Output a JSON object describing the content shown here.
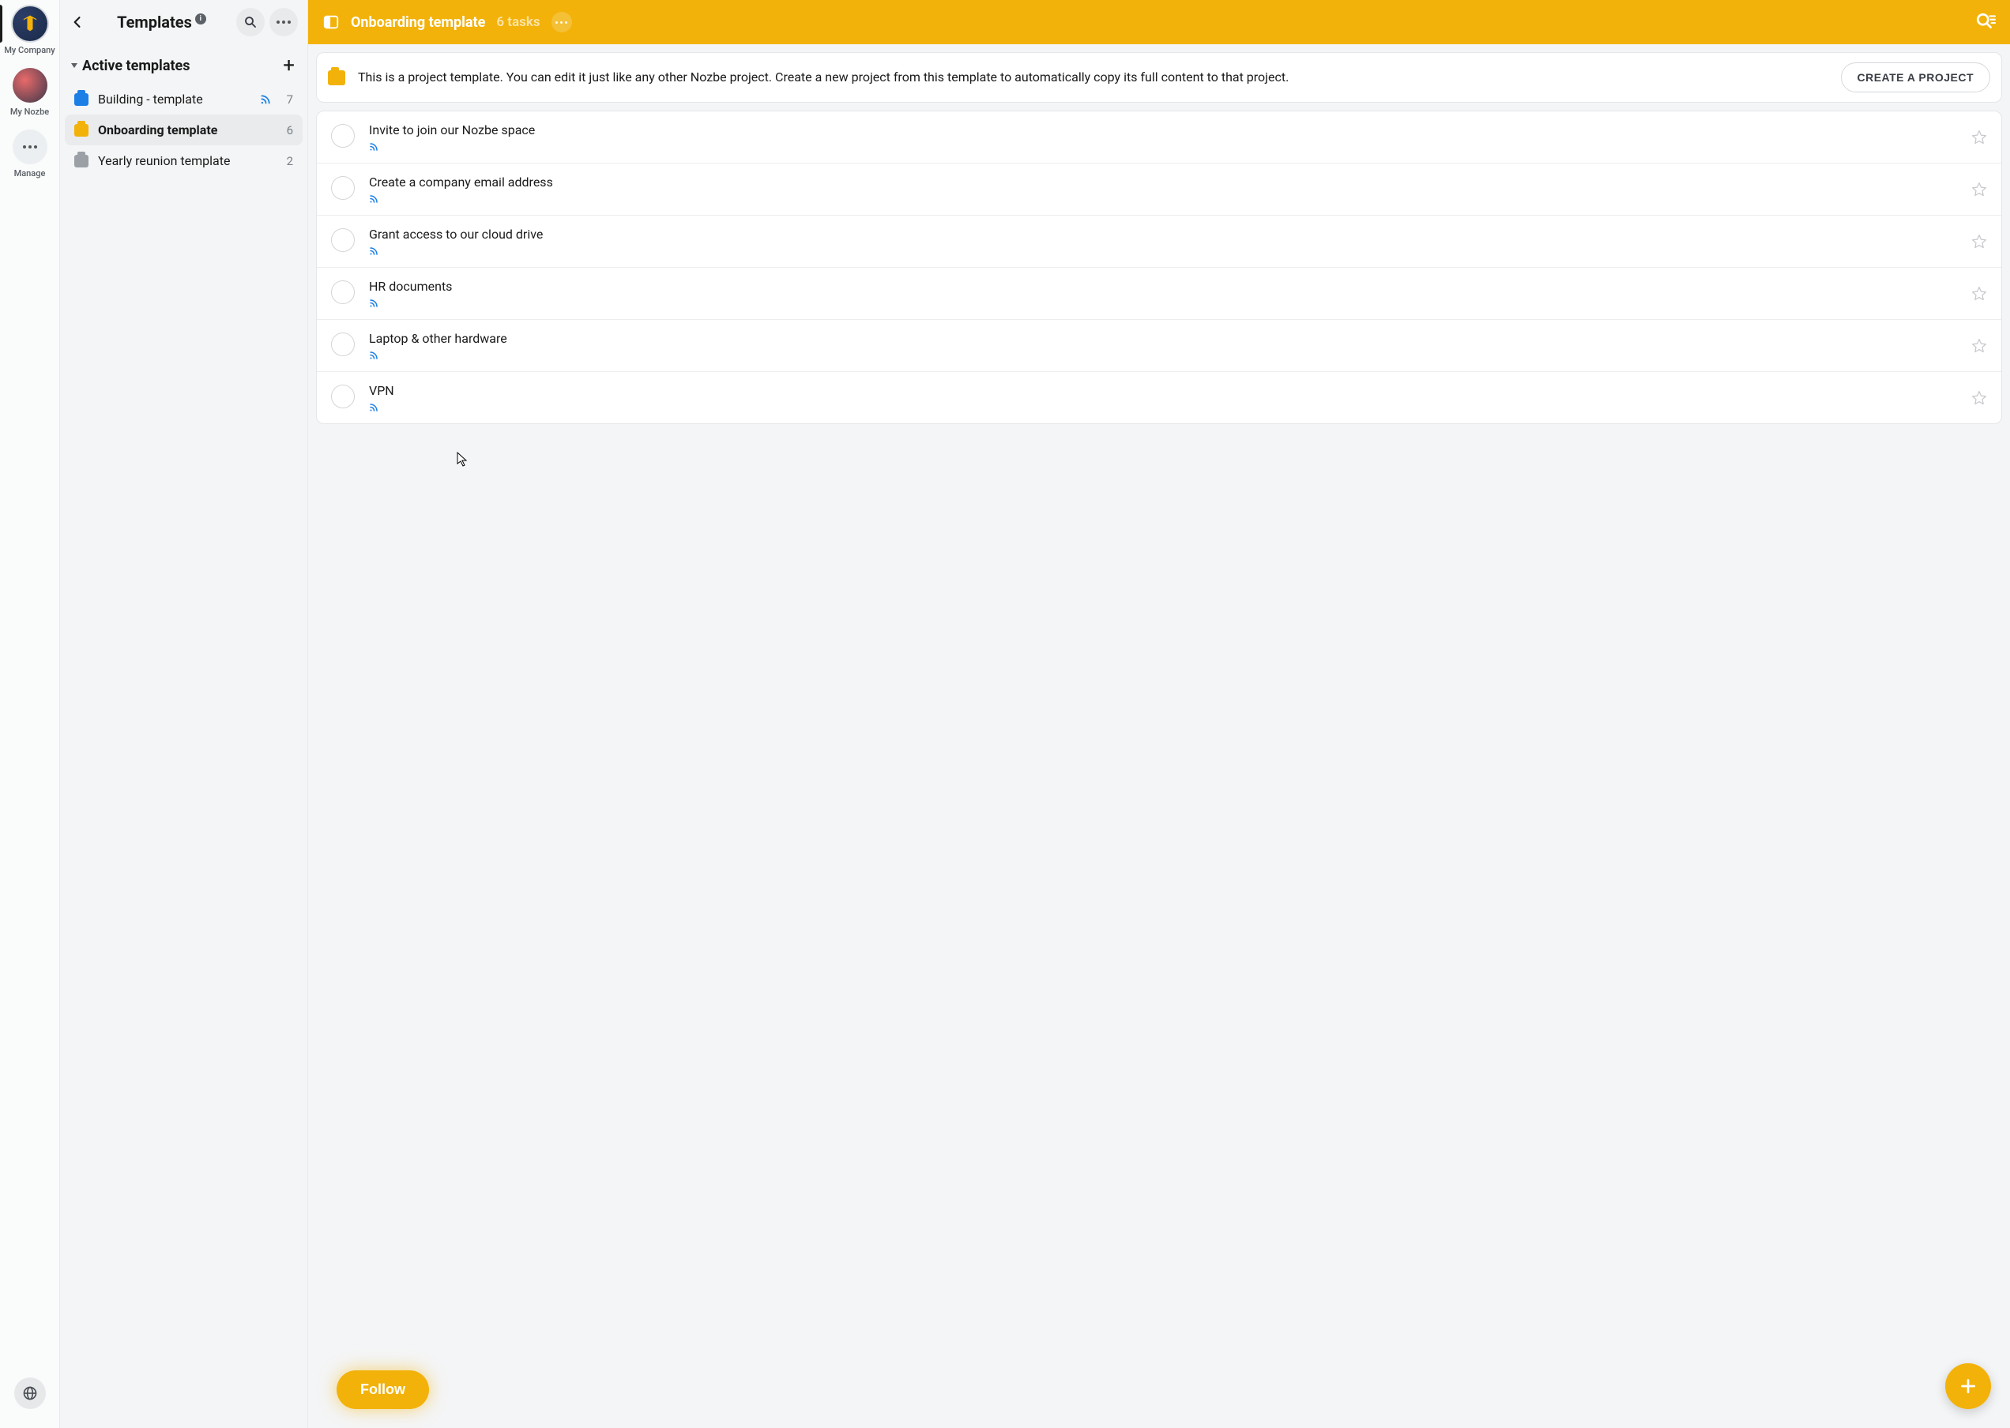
{
  "rail": {
    "items": [
      {
        "label": "My Company"
      },
      {
        "label": "My Nozbe"
      },
      {
        "label": "Manage"
      }
    ]
  },
  "sidebar": {
    "title": "Templates",
    "section_title": "Active templates",
    "templates": [
      {
        "name": "Building - template",
        "count": "7",
        "color": "blue",
        "has_rss": true
      },
      {
        "name": "Onboarding template",
        "count": "6",
        "color": "amber",
        "has_rss": false,
        "selected": true
      },
      {
        "name": "Yearly reunion template",
        "count": "2",
        "color": "grey",
        "has_rss": false
      }
    ]
  },
  "main": {
    "title": "Onboarding template",
    "task_count_label": "6 tasks",
    "banner_text": "This is a project template. You can edit it just like any other Nozbe project. Create a new project from this template to automatically copy its full content to that project.",
    "create_button": "CREATE A PROJECT",
    "tasks": [
      {
        "title": "Invite to join our Nozbe space"
      },
      {
        "title": "Create a company email address"
      },
      {
        "title": "Grant access to our cloud drive"
      },
      {
        "title": "HR documents"
      },
      {
        "title": "Laptop & other hardware"
      },
      {
        "title": "VPN"
      }
    ],
    "follow_label": "Follow"
  }
}
